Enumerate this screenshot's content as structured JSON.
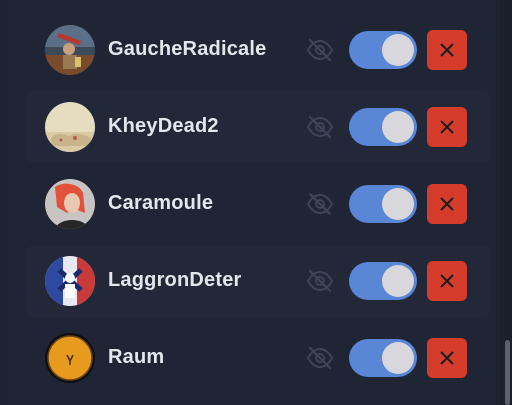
{
  "users": [
    {
      "name": "GaucheRadicale",
      "visibility_icon": "eye-off-icon",
      "enabled": true,
      "remove_icon": "close-icon"
    },
    {
      "name": "KheyDead2",
      "visibility_icon": "eye-off-icon",
      "enabled": true,
      "remove_icon": "close-icon"
    },
    {
      "name": "Caramoule",
      "visibility_icon": "eye-off-icon",
      "enabled": true,
      "remove_icon": "close-icon"
    },
    {
      "name": "LaggronDeter",
      "visibility_icon": "eye-off-icon",
      "enabled": true,
      "remove_icon": "close-icon"
    },
    {
      "name": "Raum",
      "visibility_icon": "eye-off-icon",
      "enabled": true,
      "remove_icon": "close-icon"
    }
  ],
  "colors": {
    "background": "#1f2534",
    "row_alt": "#222838",
    "toggle_on": "#5a86d6",
    "remove_button": "#d63c2b",
    "text": "#e3e6ec"
  }
}
